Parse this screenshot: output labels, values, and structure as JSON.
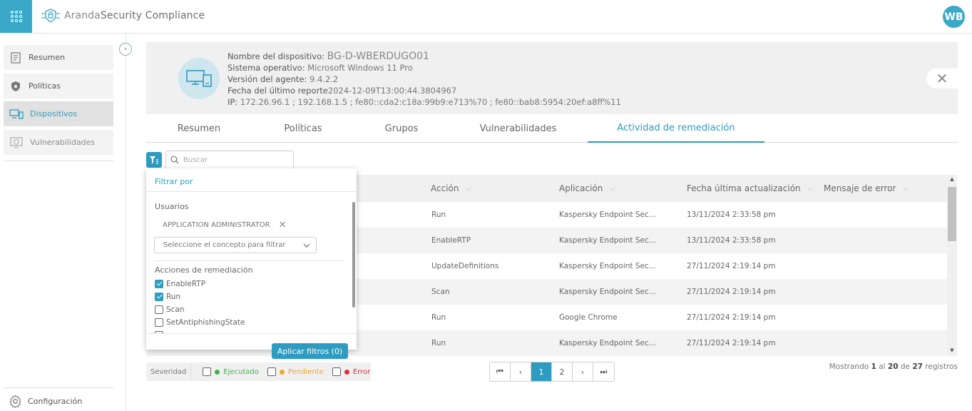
{
  "header": {
    "logo_prefix": "Aranda",
    "logo_name": "Security Compliance",
    "avatar_initials": "WB"
  },
  "sidebar": {
    "items": [
      {
        "label": "Resumen"
      },
      {
        "label": "Políticas"
      },
      {
        "label": "Dispositivos"
      },
      {
        "label": "Vulnerabilidades"
      }
    ],
    "config_label": "Configuración"
  },
  "device": {
    "name_label": "Nombre del dispositivo:",
    "name_value": "BG-D-WBERDUGO01",
    "os_label": "Sistema operativo:",
    "os_value": "Microsoft Windows 11 Pro",
    "agent_label": "Versión del agente:",
    "agent_value": "9.4.2.2",
    "report_label": "Fecha del último reporte",
    "report_value": "2024-12-09T13:00:44.3804967",
    "ip_label": "IP:",
    "ip_value": "172.26.96.1 ; 192.168.1.5 ; fe80::cda2:c18a:99b9:e713%70 ; fe80::bab8:5954:20ef:a8ff%11"
  },
  "tabs": [
    {
      "label": "Resumen"
    },
    {
      "label": "Políticas"
    },
    {
      "label": "Grupos"
    },
    {
      "label": "Vulnerabilidades"
    },
    {
      "label": "Actividad de remediación"
    }
  ],
  "search": {
    "placeholder": "Buscar"
  },
  "table": {
    "columns": [
      "Acción",
      "Aplicación",
      "Fecha última actualización",
      "Mensaje de error"
    ],
    "rows": [
      {
        "accion": "Run",
        "aplicacion": "Kaspersky Endpoint Sec...",
        "fecha": "13/11/2024 2:33:58 pm",
        "mensaje": ""
      },
      {
        "accion": "EnableRTP",
        "aplicacion": "Kaspersky Endpoint Sec...",
        "fecha": "13/11/2024 2:33:58 pm",
        "mensaje": ""
      },
      {
        "accion": "UpdateDefinitions",
        "aplicacion": "Kaspersky Endpoint Sec...",
        "fecha": "27/11/2024 2:19:14 pm",
        "mensaje": ""
      },
      {
        "accion": "Scan",
        "aplicacion": "Kaspersky Endpoint Sec...",
        "fecha": "27/11/2024 2:19:14 pm",
        "mensaje": ""
      },
      {
        "accion": "Run",
        "aplicacion": "Google Chrome",
        "fecha": "27/11/2024 2:19:14 pm",
        "mensaje": ""
      },
      {
        "accion": "Run",
        "aplicacion": "Kaspersky Endpoint Sec...",
        "fecha": "27/11/2024 2:19:14 pm",
        "mensaje": ""
      }
    ]
  },
  "filter_popup": {
    "title": "Filtrar por",
    "users_label": "Usuarios",
    "user_chip": "APPLICATION ADMINISTRATOR",
    "select_placeholder": "Seleccione el concepto para filtrar",
    "actions_label": "Acciones de remediación",
    "actions": [
      {
        "label": "EnableRTP",
        "checked": true
      },
      {
        "label": "Run",
        "checked": true
      },
      {
        "label": "Scan",
        "checked": false
      },
      {
        "label": "SetAntiphishingState",
        "checked": false
      }
    ],
    "apply_label": "Aplicar filtros (0)"
  },
  "severity": {
    "title": "Severidad",
    "items": [
      {
        "label": "Ejecutado",
        "color": "#3bb54a"
      },
      {
        "label": "Pendiente",
        "color": "#f5a623"
      },
      {
        "label": "Error",
        "color": "#e0303a"
      }
    ]
  },
  "pagination": {
    "pages": [
      "1",
      "2"
    ],
    "current": "1",
    "showing_prefix": "Mostrando",
    "showing_from": "1",
    "showing_mid": "al",
    "showing_to": "20",
    "showing_of": "de",
    "showing_total": "27",
    "showing_suffix": "registros"
  },
  "colors": {
    "accent": "#2e9cc0",
    "panel_bg": "#f0f0f0"
  }
}
